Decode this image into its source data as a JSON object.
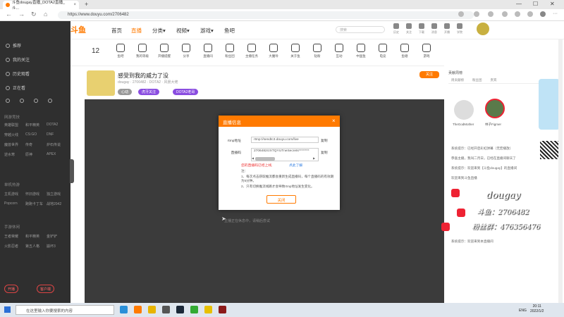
{
  "browser": {
    "tab_title": "斗鱼dougay直播_DOTA2直播_斗...",
    "tab_close": "×",
    "new_tab": "+",
    "url": "https://www.douyu.com/2706482",
    "minimize": "—",
    "maximize": "☐",
    "close": "✕"
  },
  "site": {
    "logo": "斗鱼",
    "nav": [
      "首页",
      "直播",
      "分类▾",
      "视频▾",
      "游戏▾",
      "鱼吧"
    ],
    "search_placeholder": "搜索",
    "header_icons": [
      "历史",
      "关注",
      "下载",
      "消息",
      "开播",
      "学院"
    ]
  },
  "sidebar": {
    "items": [
      "推荐",
      "我的关注",
      "历史观看",
      "正在看"
    ],
    "section1": "网游竞技",
    "grid1": [
      "英雄联盟",
      "和平精英",
      "DOTA2",
      "穿越火线",
      "CS:GO",
      "DNF",
      "魔兽世界",
      "传奇",
      "炉石传说",
      "逆水寒",
      "原神",
      "APEX"
    ],
    "section2": "单机热游",
    "grid2": [
      "主机游戏",
      "怀旧游戏",
      "独立游戏",
      "Popcorn",
      "跑跑卡丁车",
      "战地2042"
    ],
    "section3": "手游休闲",
    "grid3": [
      "王者荣耀",
      "和平精英",
      "金铲铲",
      "火影忍者",
      "第五人格",
      "崩坏3"
    ],
    "btn_left": "开播",
    "btn_right": "客户端"
  },
  "categories": {
    "count": "12",
    "labels": [
      "鱼吧",
      "我的等级",
      "开播提醒",
      "分享",
      "直播间",
      "粉丝团",
      "主播任务",
      "大魔导",
      "关于鱼",
      "钻粉",
      "互动",
      "中国鱼",
      "电竞",
      "鱼塘",
      "游戏"
    ]
  },
  "room": {
    "title": "感受到我的威力了没",
    "meta": "dougay · 2706482 · DOTA2 · 风景大佬",
    "tags": [
      "心动",
      "虎牙关注",
      "DOTA2老哥"
    ],
    "follow": "关注"
  },
  "player": {
    "hint": "主播正在休息中，请稍后尝试"
  },
  "modal": {
    "title": "直播信息",
    "close": "×",
    "rtmp_label": "rtmp地址",
    "rtmp_value": "rtmp://sendtc3.douyu.com/live",
    "key_label": "直播码",
    "key_value": "2706482rzXTQYUTneSecrets********",
    "copy": "复制",
    "warn": "您的直播码已经上线,",
    "learn_more": "点此了解",
    "note_title": "注：",
    "note1": "1、每次点击获取推流都会重新生成直播码，每个直播码的有效期为5分钟。",
    "note2": "2、只有切换推流线路才会导致rtmp地址发生变化。",
    "ok": "关闭"
  },
  "right_panel": {
    "rank_title": "贡献周榜",
    "rank_tabs": [
      "周贡献榜",
      "粉丝团",
      "贵宾"
    ],
    "top_users": [
      "TheGodMother",
      "林子Figmer"
    ],
    "chat": [
      "系统提示：已经开启彩虹弹幕（无宏播放）",
      "恭喜主播，我叫二月日，已经在直播间聊天了",
      "系统提示：欢迎来到【斗鱼dougay】的直播间",
      "欢迎来到斗鱼直播",
      "系统提示：欢迎来到本直播间"
    ]
  },
  "overlay": {
    "name": "dougay",
    "room_line": "斗鱼：2706482",
    "fan_line": "粉丝群：476356476"
  },
  "taskbar": {
    "search_placeholder": "在这里输入你要搜索的内容",
    "lang": "ENG",
    "time": "20:11",
    "date": "2022/1/2"
  }
}
